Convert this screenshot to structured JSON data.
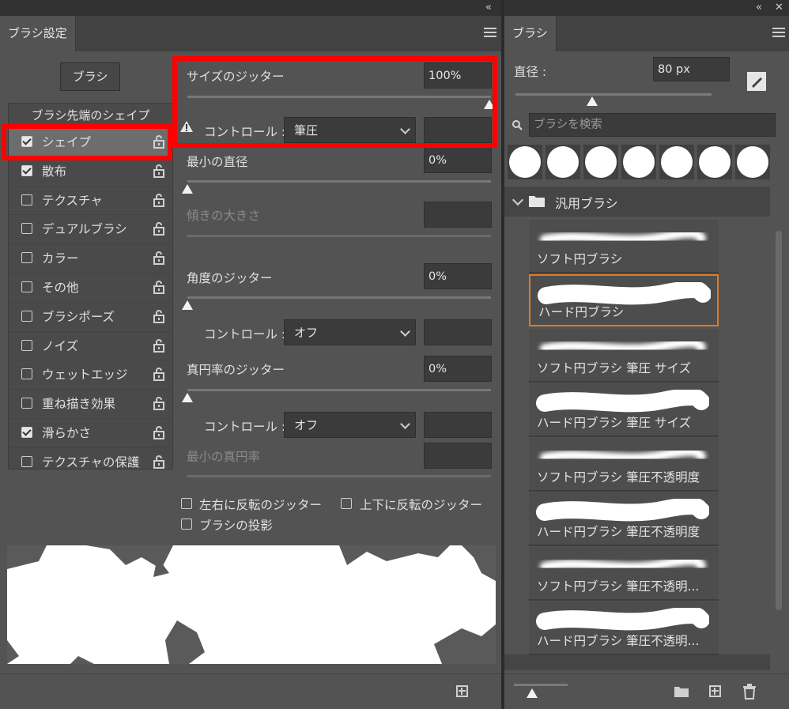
{
  "left_panel": {
    "tab_title": "ブラシ設定",
    "brush_button": "ブラシ",
    "list_header": "ブラシ先端のシェイプ",
    "items": [
      {
        "label": "シェイプ",
        "checked": true,
        "selected": true
      },
      {
        "label": "散布",
        "checked": true,
        "selected": false
      },
      {
        "label": "テクスチャ",
        "checked": false,
        "selected": false
      },
      {
        "label": "デュアルブラシ",
        "checked": false,
        "selected": false
      },
      {
        "label": "カラー",
        "checked": false,
        "selected": false
      },
      {
        "label": "その他",
        "checked": false,
        "selected": false
      },
      {
        "label": "ブラシポーズ",
        "checked": false,
        "selected": false
      },
      {
        "label": "ノイズ",
        "checked": false,
        "selected": false
      },
      {
        "label": "ウェットエッジ",
        "checked": false,
        "selected": false
      },
      {
        "label": "重ね描き効果",
        "checked": false,
        "selected": false
      },
      {
        "label": "滑らかさ",
        "checked": true,
        "selected": false
      },
      {
        "label": "テクスチャの保護",
        "checked": false,
        "selected": false
      }
    ],
    "size_jitter": {
      "label": "サイズのジッター",
      "value": "100%"
    },
    "control_label": "コントロール :",
    "control1_value": "筆圧",
    "min_diameter": {
      "label": "最小の直径",
      "value": "0%"
    },
    "tilt_scale": {
      "label": "傾きの大きさ"
    },
    "angle_jitter": {
      "label": "角度のジッター",
      "value": "0%"
    },
    "control2_value": "オフ",
    "roundness_jitter": {
      "label": "真円率のジッター",
      "value": "0%"
    },
    "control3_value": "オフ",
    "min_roundness": {
      "label": "最小の真円率"
    },
    "flip_x": "左右に反転のジッター",
    "flip_y": "上下に反転のジッター",
    "projection": "ブラシの投影",
    "icons": {
      "collapse": "double-chevron-left-icon",
      "menu": "hamburger-menu-icon",
      "warning": "warning-icon",
      "lock": "lock-icon",
      "new": "new-preset-icon"
    }
  },
  "right_panel": {
    "tab_title": "ブラシ",
    "size_label": "直径 :",
    "size_value": "80 px",
    "search_placeholder": "ブラシを検索",
    "group_name": "汎用ブラシ",
    "brushes": [
      {
        "name": "ソフト円ブラシ",
        "soft": true
      },
      {
        "name": "ハード円ブラシ",
        "soft": false,
        "selected": true
      },
      {
        "name": "ソフト円ブラシ 筆圧 サイズ",
        "soft": true
      },
      {
        "name": "ハード円ブラシ 筆圧 サイズ",
        "soft": false
      },
      {
        "name": "ソフト円ブラシ 筆圧不透明度",
        "soft": true
      },
      {
        "name": "ハード円ブラシ 筆圧不透明度",
        "soft": false
      },
      {
        "name": "ソフト円ブラシ 筆圧不透明...",
        "soft": true
      },
      {
        "name": "ハード円ブラシ 筆圧不透明...",
        "soft": false
      }
    ],
    "colors": {
      "accent_selection": "#e07b22",
      "highlight": "#ff0000"
    }
  }
}
